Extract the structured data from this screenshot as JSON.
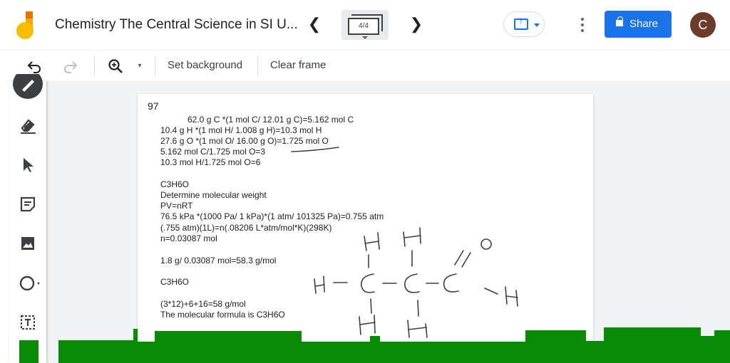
{
  "app": {
    "title": "Chemistry The Central Science in SI U...",
    "frame_counter": "4/4",
    "share_label": "Share",
    "avatar_initial": "C"
  },
  "toolbar": {
    "set_background_label": "Set background",
    "clear_frame_label": "Clear frame"
  },
  "frame": {
    "number": "97",
    "lines": [
      "62.0 g C *(1 mol C/ 12.01 g C)=5.162 mol C",
      "10.4 g H *(1 mol H/ 1.008 g H)=10.3 mol H",
      "27.6 g O *(1 mol O/ 16.00 g O)=1.725 mol O",
      "5.162 mol C/1.725 mol O=3",
      "10.3 mol H/1.725 mol O=6",
      "C3H6O",
      "Determine molecular weight",
      "PV=nRT",
      "76.5 kPa *(1000 Pa/ 1 kPa)*(1 atm/ 101325 Pa)=0.755 atm",
      "(.755 atm)(1L)=n(.08206 L*atm/mol*K)(298K)",
      "n=0.03087 mol",
      "1.8 g/ 0.03087 mol=58.3 g/mol",
      "C3H6O",
      "(3*12)+6+16=58 g/mol",
      "The molecular formula is C3H6O"
    ]
  },
  "colors": {
    "accent": "#1a73e8",
    "ink_green": "#0a8a06",
    "avatar": "#6d3b2c"
  },
  "icons": {
    "logo": "jamboard-logo-icon",
    "undo": "undo-icon",
    "redo": "redo-icon",
    "zoom": "zoom-in-icon",
    "pen": "pen-icon",
    "eraser": "eraser-icon",
    "select": "cursor-arrow-icon",
    "sticky": "sticky-note-icon",
    "image": "image-icon",
    "circle": "circle-shape-icon",
    "textbox": "text-box-icon"
  }
}
